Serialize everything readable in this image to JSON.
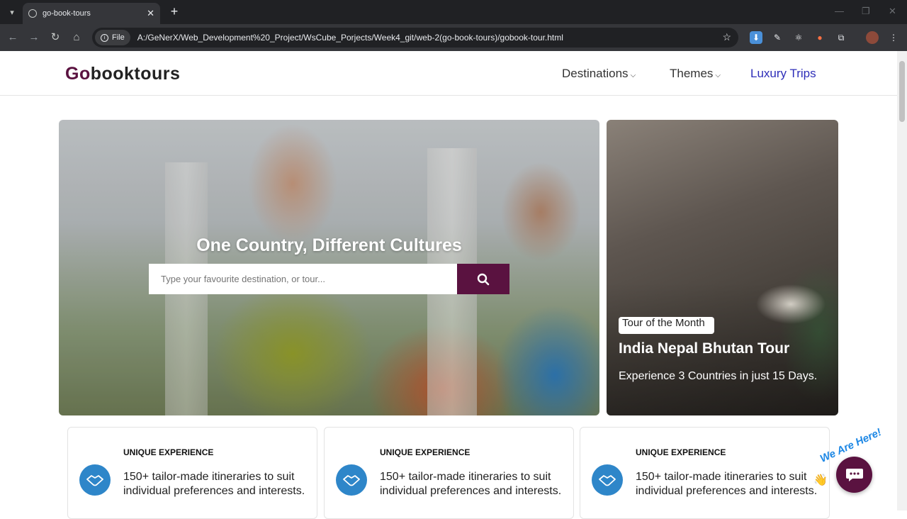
{
  "browser": {
    "tab_title": "go-book-tours",
    "new_tab_label": "+",
    "url_chip_label": "File",
    "url": "A:/GeNerX/Web_Development%20_Project/WsCube_Porjects/Week4_git/web-2(go-book-tours)/gobook-tour.html"
  },
  "header": {
    "logo_prefix": "Go",
    "logo_suffix": "booktours",
    "nav": [
      {
        "label": "Destinations",
        "has_dropdown": true
      },
      {
        "label": "Themes",
        "has_dropdown": true
      },
      {
        "label": "Luxury Trips",
        "has_dropdown": false
      }
    ]
  },
  "hero": {
    "title": "One Country, Different Cultures",
    "search_placeholder": "Type your favourite destination, or tour...",
    "search_icon": "search-icon"
  },
  "tour_card": {
    "badge": "Tour of the Month",
    "title": "India Nepal Bhutan Tour",
    "subtitle": "Experience 3 Countries in just 15 Days."
  },
  "features": [
    {
      "title": "UNIQUE EXPERIENCE",
      "text": "150+ tailor-made itineraries to suit individual preferences and interests.",
      "icon": "handshake-icon"
    },
    {
      "title": "UNIQUE EXPERIENCE",
      "text": "150+ tailor-made itineraries to suit individual preferences and interests.",
      "icon": "handshake-icon"
    },
    {
      "title": "UNIQUE EXPERIENCE",
      "text": "150+ tailor-made itineraries to suit individual preferences and interests.",
      "icon": "handshake-icon"
    }
  ],
  "chat": {
    "label": "We Are Here!",
    "icon": "chat-icon"
  },
  "colors": {
    "brand": "#5a1240",
    "luxury_link": "#2e2eb8",
    "feature_icon": "#2e86c9",
    "chat_label": "#1e88e5"
  }
}
